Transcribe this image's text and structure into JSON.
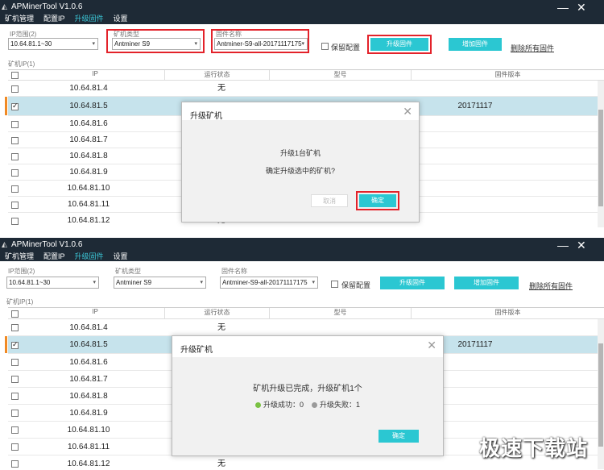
{
  "app": {
    "title": "APMinerTool V1.0.6",
    "menu": [
      "矿机管理",
      "配置IP",
      "升级固件",
      "设置"
    ],
    "active_menu": "升级固件",
    "minimize": "—",
    "close": "✕"
  },
  "toolbar": {
    "ip_range_label": "IP范围(2)",
    "ip_range_value": "10.64.81.1~30",
    "miner_type_label": "矿机类型",
    "miner_type_value": "Antminer S9",
    "firmware_label": "固件名称",
    "firmware_value": "Antminer-S9-all-20171117175",
    "keep_config_label": "保留配置",
    "upgrade_btn": "升级固件",
    "add_btn": "增加固件",
    "delete_all": "删除所有固件"
  },
  "grid": {
    "label": "矿机IP(1)",
    "columns": [
      "IP",
      "运行状态",
      "型号",
      "固件版本"
    ],
    "rows": [
      {
        "ip": "10.64.81.4",
        "status": "无",
        "firmware": "",
        "checked": false
      },
      {
        "ip": "10.64.81.5",
        "status": "",
        "firmware": "20171117",
        "checked": true
      },
      {
        "ip": "10.64.81.6",
        "status": "",
        "firmware": "",
        "checked": false
      },
      {
        "ip": "10.64.81.7",
        "status": "",
        "firmware": "",
        "checked": false
      },
      {
        "ip": "10.64.81.8",
        "status": "",
        "firmware": "",
        "checked": false
      },
      {
        "ip": "10.64.81.9",
        "status": "",
        "firmware": "",
        "checked": false
      },
      {
        "ip": "10.64.81.10",
        "status": "",
        "firmware": "",
        "checked": false
      },
      {
        "ip": "10.64.81.11",
        "status": "",
        "firmware": "",
        "checked": false
      },
      {
        "ip": "10.64.81.12",
        "status": "无",
        "firmware": "",
        "checked": false
      }
    ]
  },
  "dialog1": {
    "title": "升级矿机",
    "line1": "升级1台矿机",
    "line2": "确定升级选中的矿机?",
    "cancel": "取消",
    "ok": "确定"
  },
  "dialog2": {
    "title": "升级矿机",
    "line1": "矿机升级已完成，升级矿机1个",
    "success": "升级成功：0",
    "fail": "升级失败：1",
    "ok": "确定",
    "success_color": "#7ac143",
    "fail_color": "#9a9a9a"
  },
  "watermark": "极速下载站",
  "colors": {
    "accent": "#2bc7d2",
    "titlebar": "#1e2a36",
    "highlight": "#e3222a",
    "selected_row": "#c6e3ec"
  }
}
